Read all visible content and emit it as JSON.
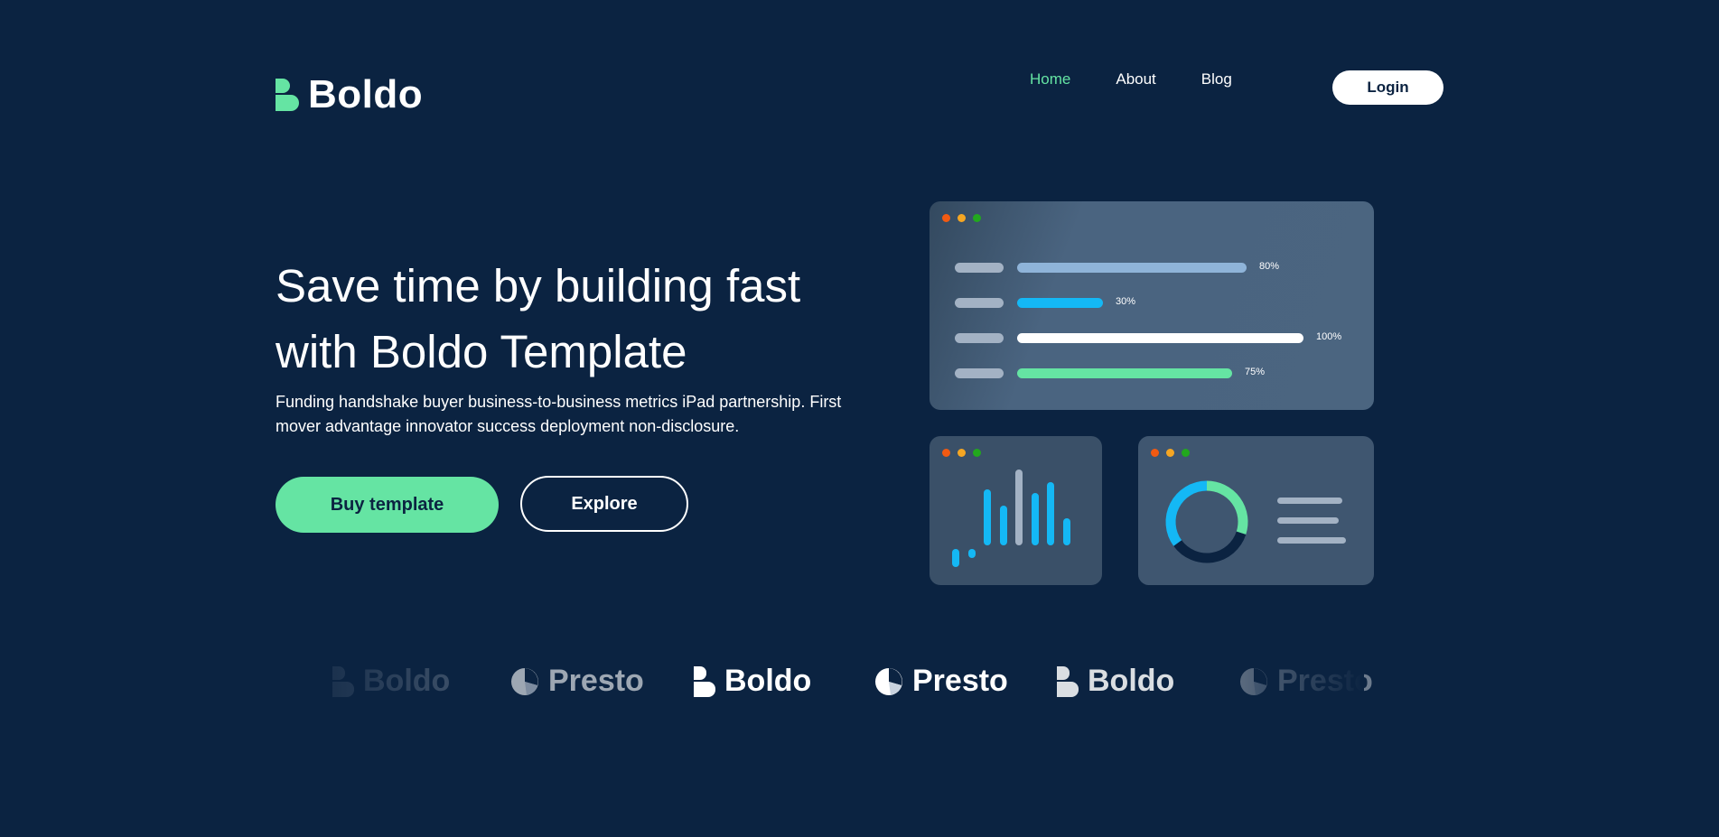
{
  "header": {
    "brand": "Boldo",
    "nav": [
      {
        "label": "Home",
        "active": true
      },
      {
        "label": "About",
        "active": false
      },
      {
        "label": "Blog",
        "active": false
      }
    ],
    "login_label": "Login"
  },
  "hero": {
    "title": "Save time by building fast with Boldo Template",
    "subtitle": "Funding handshake buyer business-to-business metrics iPad partnership. First mover advantage innovator success deployment non-disclosure.",
    "buy_label": "Buy template",
    "explore_label": "Explore"
  },
  "dashboard": {
    "progress": [
      {
        "percent": 80,
        "label": "80%",
        "color": "#8fb4d9"
      },
      {
        "percent": 30,
        "label": "30%",
        "color": "#14b8f5"
      },
      {
        "percent": 100,
        "label": "100%",
        "color": "#ffffff"
      },
      {
        "percent": 75,
        "label": "75%",
        "color": "#65e4a3"
      }
    ],
    "bars": [
      {
        "value": 20,
        "color": "#14b8f5"
      },
      {
        "value": 10,
        "color": "#14b8f5"
      },
      {
        "value": 62,
        "color": "#14b8f5"
      },
      {
        "value": 44,
        "color": "#14b8f5"
      },
      {
        "value": 84,
        "color": "#a3b2c4"
      },
      {
        "value": 58,
        "color": "#14b8f5"
      },
      {
        "value": 70,
        "color": "#14b8f5"
      },
      {
        "value": 30,
        "color": "#14b8f5"
      }
    ],
    "donut": [
      {
        "fraction": 0.3,
        "color": "#65e4a3"
      },
      {
        "fraction": 0.35,
        "color": "#0b2341"
      },
      {
        "fraction": 0.35,
        "color": "#14b8f5"
      }
    ]
  },
  "brands": [
    {
      "name": "Boldo",
      "kind": "boldo",
      "opacity": 0.25
    },
    {
      "name": "Presto",
      "kind": "presto",
      "opacity": 0.6
    },
    {
      "name": "Boldo",
      "kind": "boldo",
      "opacity": 1
    },
    {
      "name": "Presto",
      "kind": "presto",
      "opacity": 1
    },
    {
      "name": "Boldo",
      "kind": "boldo",
      "opacity": 0.85
    },
    {
      "name": "Presto",
      "kind": "presto",
      "opacity": 0.4
    }
  ],
  "colors": {
    "background": "#0b2341",
    "accent": "#65e4a3",
    "blue": "#14b8f5"
  }
}
